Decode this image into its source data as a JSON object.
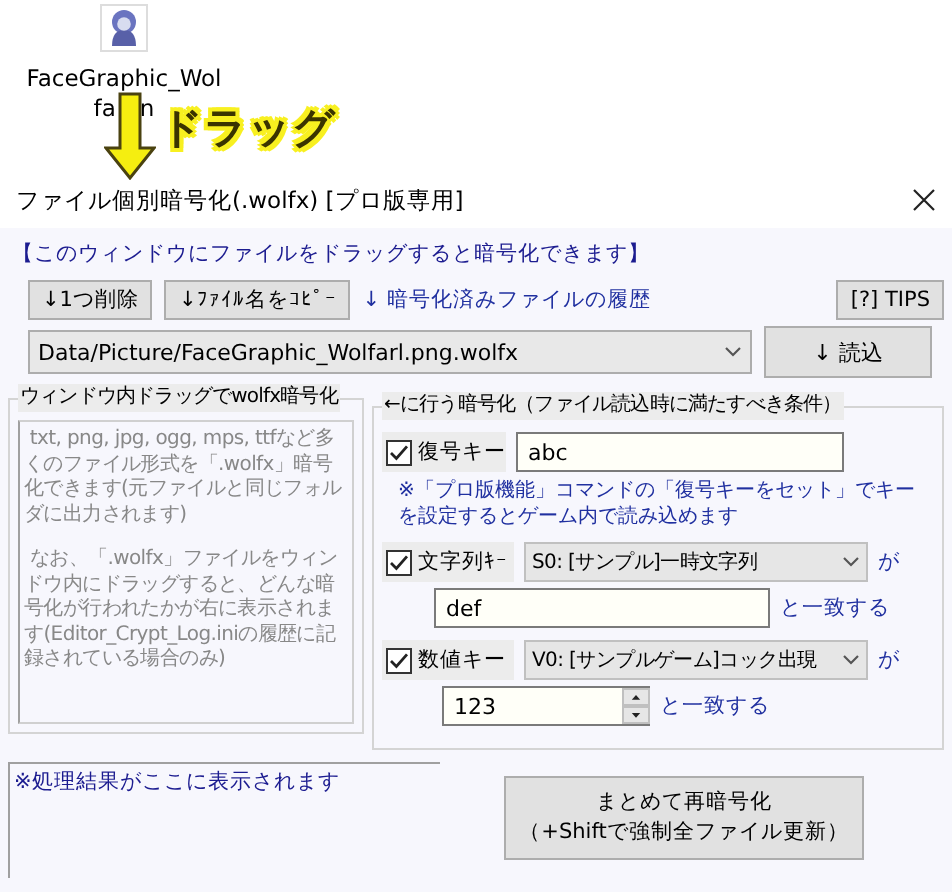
{
  "desktop_icon": {
    "label": "FaceGraphic_Wol",
    "label_rest": [
      "fa",
      "n"
    ]
  },
  "annotation": {
    "text": "ドラッグ"
  },
  "window": {
    "title": "ファイル個別暗号化(.wolfx) [プロ版専用]"
  },
  "notice": "【このウィンドウにファイルをドラッグすると暗号化できます】",
  "toolbar": {
    "buttons": [
      "↓1つ削除",
      "↓ﾌｧｲﾙ名をｺﾋﾟｰ"
    ],
    "history_label": "↓ 暗号化済みファイルの履歴",
    "tips_button": "[?] TIPS"
  },
  "file_select": {
    "value": "Data/Picture/FaceGraphic_Wolfarl.png.wolfx"
  },
  "load_button": "↓ 読込",
  "drag_group": {
    "title": "ウィンドウ内ドラッグでwolfx暗号化",
    "paragraphs": [
      " txt, png, jpg, ogg, mps, ttfなど多くのファイル形式を「.wolfx」暗号化できます(元ファイルと同じフォルダに出力されます)",
      " なお、「.wolfx」ファイルをウィンドウ内にドラッグすると、どんな暗号化が行われたかが右に表示されます(Editor_Crypt_Log.iniの履歴に記録されている場合のみ)"
    ]
  },
  "conditions": {
    "title": "←に行う暗号化（ファイル読込時に満たすべき条件）",
    "rows": [
      {
        "kind": "text",
        "label": "復号キー",
        "checked": true,
        "value": "abc",
        "note": "※「プロ版機能」コマンドの「復号キーをセット」でキーを設定するとゲーム内で読み込めます"
      },
      {
        "kind": "select",
        "label": "文字列ｷｰ",
        "checked": true,
        "option": "S0: [サンプル]一時文字列",
        "suffix": "が",
        "value": "def",
        "match": "と一致する"
      },
      {
        "kind": "spin",
        "label": "数値キー",
        "checked": true,
        "option": "V0: [サンプルゲーム]コック出現",
        "suffix": "が",
        "value": "123",
        "match": "と一致する"
      }
    ]
  },
  "result": {
    "text": "※処理結果がここに表示されます"
  },
  "recrypt_button": {
    "lines": [
      "まとめて再暗号化",
      "（+Shiftで強制全ファイル更新）"
    ]
  }
}
